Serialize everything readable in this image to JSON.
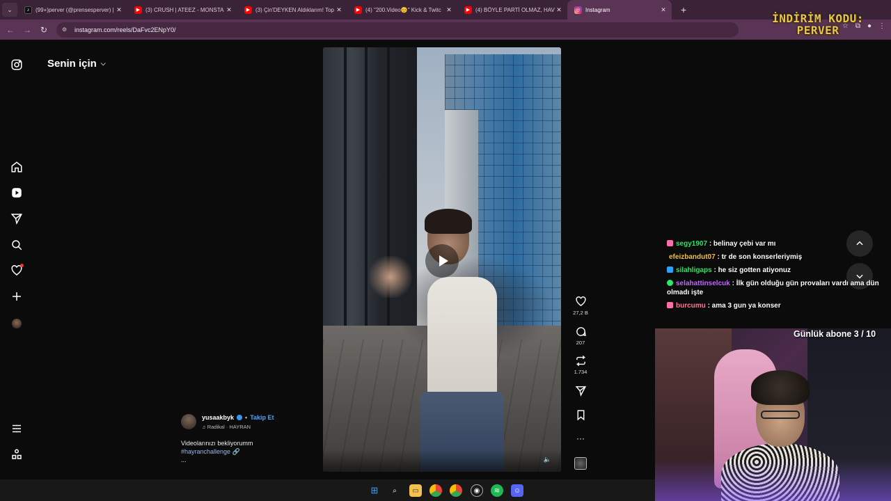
{
  "browser": {
    "tabs": [
      {
        "title": "(99+)perver (@prensesperver) |",
        "favicon": "tiktok-icon",
        "color": "#111111",
        "active": false
      },
      {
        "title": "(3) CRUSH | ATEEZ - MONSTA X",
        "favicon": "youtube-icon",
        "color": "#ff0000",
        "active": false
      },
      {
        "title": "(3) Çin'DEYKEN Aldıklarım! Top",
        "favicon": "youtube-icon",
        "color": "#ff0000",
        "active": false
      },
      {
        "title": "(4) \"200.Video😊\" Kick & Twitc",
        "favicon": "youtube-icon",
        "color": "#ff0000",
        "active": false
      },
      {
        "title": "(4) BÖYLE PARTİ OLMAZ, HAVU",
        "favicon": "youtube-icon",
        "color": "#ff0000",
        "active": false
      },
      {
        "title": "Instagram",
        "favicon": "instagram-icon",
        "color": "#d62976",
        "active": true
      }
    ],
    "url": "instagram.com/reels/DaFvc2ENpY0/"
  },
  "promo": {
    "line1": "İNDİRİM KODU:",
    "line2": "PERVER"
  },
  "instagram": {
    "feed_title": "Senin için",
    "likes": "27,2 B",
    "comments": "207",
    "reposts": "1.734",
    "author": "yusaakbyk",
    "follow_label": "Takip Et",
    "audio": "Radikal · HAYRAN",
    "caption": "Videolarınızı bekliyorumm",
    "hashtag": "#hayranchallenge",
    "more": "..."
  },
  "chat": [
    {
      "user": "segy1907",
      "color": "#2ee66b",
      "badge": "#ff6ea8",
      "text": ": belinay çebi var mı"
    },
    {
      "user": "efeizbandut07",
      "color": "#f0c24a",
      "badge": "",
      "text": ": tr de son konserleriymiş"
    },
    {
      "user": "silahligaps",
      "color": "#2ee66b",
      "badge": "#2aa0ff",
      "text": ": he siz gotten atiyonuz"
    },
    {
      "user": "selahattinselcuk",
      "color": "#c06bff",
      "badge": "#2ee66b",
      "text": ": İlk gün olduğu gün provaları vardı ama dün olmadı işte"
    },
    {
      "user": "burcumu",
      "color": "#ff7a9a",
      "badge": "#ff6ea8",
      "text": ": ama 3 gun ya konser"
    }
  ],
  "sub_goal": "Günlük abone 3 / 10"
}
